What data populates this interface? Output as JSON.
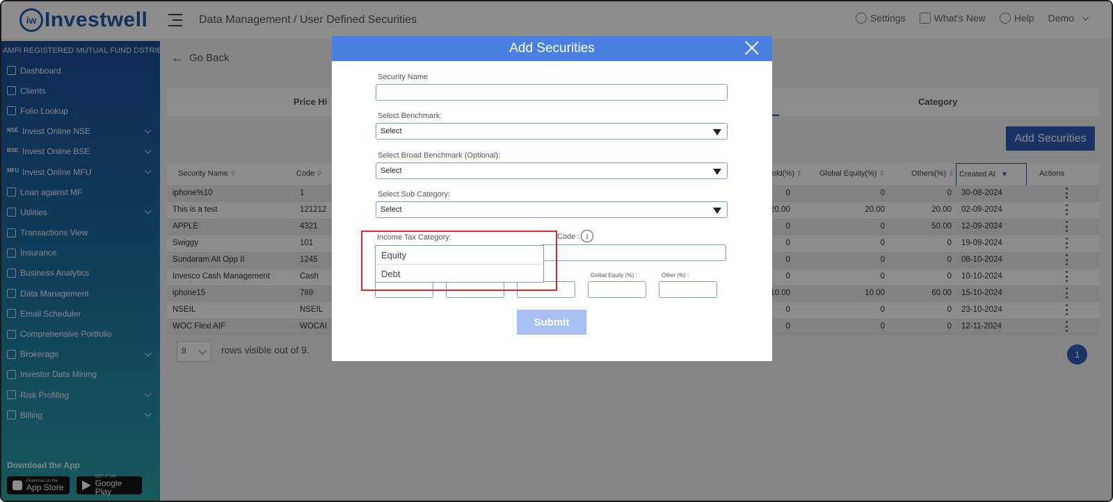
{
  "header": {
    "logo_mark": "iw",
    "logo_text": "Investwell",
    "breadcrumb": "Data Management / User Defined Securities",
    "settings": "Settings",
    "whats_new": "What's New",
    "help": "Help",
    "user": "Demo"
  },
  "sidebar": {
    "title": "AMFI REGISTERED MUTUAL FUND DSTRIBUTOR",
    "items": [
      {
        "label": "Dashboard",
        "icon": "home-icon",
        "chevron": false
      },
      {
        "label": "Clients",
        "icon": "users-icon",
        "chevron": false
      },
      {
        "label": "Folio Lookup",
        "icon": "folio-search-icon",
        "chevron": false
      },
      {
        "label": "Invest Online NSE",
        "icon": "NSE",
        "chevron": true
      },
      {
        "label": "Invest Online BSE",
        "icon": "BSE",
        "chevron": true
      },
      {
        "label": "Invest Online MFU",
        "icon": "MFU",
        "chevron": true
      },
      {
        "label": "Loan against MF",
        "icon": "loan-icon",
        "chevron": false
      },
      {
        "label": "Utilities",
        "icon": "utilities-icon",
        "chevron": true
      },
      {
        "label": "Transactions View",
        "icon": "transactions-icon",
        "chevron": false
      },
      {
        "label": "Insurance",
        "icon": "insurance-icon",
        "chevron": false
      },
      {
        "label": "Business Analytics",
        "icon": "analytics-icon",
        "chevron": false
      },
      {
        "label": "Data Management",
        "icon": "database-icon",
        "chevron": false
      },
      {
        "label": "Email Scheduler",
        "icon": "email-icon",
        "chevron": false
      },
      {
        "label": "Comprehensive Portfolio",
        "icon": "portfolio-icon",
        "chevron": false
      },
      {
        "label": "Brokerage",
        "icon": "brokerage-icon",
        "chevron": true
      },
      {
        "label": "Investor Data Mining",
        "icon": "data-mining-icon",
        "chevron": false
      },
      {
        "label": "Risk Profiling",
        "icon": "risk-icon",
        "chevron": true
      },
      {
        "label": "Billing",
        "icon": "billing-icon",
        "chevron": true
      }
    ],
    "download_title": "Download the App",
    "app_store_small": "Download on the",
    "app_store": "App Store",
    "google_play_small": "GET IT ON",
    "google_play": "Google Play"
  },
  "main": {
    "go_back": "Go Back",
    "tab_price_history": "Price Hi",
    "tab_category": "Category",
    "add_securities": "Add Securities",
    "columns": {
      "security_name": "Security Name",
      "code": "Code",
      "gold": "old(%)",
      "global_equity": "Global Equity(%)",
      "others": "Others(%)",
      "created_at": "Created At",
      "actions": "Actions"
    },
    "rows": [
      {
        "name": "iphone%10",
        "code": "1",
        "gold": "0",
        "global_equity": "0",
        "others": "0",
        "created_at": "30-08-2024"
      },
      {
        "name": "This is a test",
        "code": "121212",
        "gold": "20.00",
        "global_equity": "20.00",
        "others": "20.00",
        "created_at": "02-09-2024"
      },
      {
        "name": "APPLE",
        "code": "4321",
        "gold": "0",
        "global_equity": "0",
        "others": "50.00",
        "created_at": "12-09-2024"
      },
      {
        "name": "Swiggy",
        "code": "101",
        "gold": "0",
        "global_equity": "0",
        "others": "0",
        "created_at": "19-09-2024"
      },
      {
        "name": "Sundaram Alt Opp II",
        "code": "1245",
        "gold": "0",
        "global_equity": "0",
        "others": "0",
        "created_at": "08-10-2024"
      },
      {
        "name": "Invesco Cash Management",
        "code": "Cash",
        "gold": "0",
        "global_equity": "0",
        "others": "0",
        "created_at": "10-10-2024"
      },
      {
        "name": "iphone15",
        "code": "789",
        "gold": "10.00",
        "global_equity": "10.00",
        "others": "60.00",
        "created_at": "15-10-2024"
      },
      {
        "name": "NSEIL",
        "code": "NSEIL",
        "gold": "0",
        "global_equity": "0",
        "others": "0",
        "created_at": "23-10-2024"
      },
      {
        "name": "WOC Flexi AIF",
        "code": "WOCAI",
        "gold": "0",
        "global_equity": "0",
        "others": "0",
        "created_at": "12-11-2024"
      }
    ],
    "rows_per_page": "9",
    "rows_text": "rows visible out of 9.",
    "page": "1"
  },
  "modal": {
    "title": "Add Securities",
    "security_name_label": "Security Name",
    "security_name_value": "",
    "benchmark_label": "Select Benchmark:",
    "benchmark_value": "Select",
    "broad_benchmark_label": "Select Broad Benchmark (Optional):",
    "broad_benchmark_value": "Select",
    "sub_category_label": "Select Sub Category:",
    "sub_category_value": "Select",
    "income_tax_label": "Income Tax Category:",
    "code_label": "Code :",
    "global_equity_label": "Global Equity (%) :",
    "other_label": "Other (%) :",
    "dropdown_options": [
      "Equity",
      "Debt"
    ],
    "submit": "Submit"
  },
  "colors": {
    "brand": "#1e5aa8",
    "modal_header": "#4a80e2",
    "highlight": "#e32626",
    "submit_disabled": "#a7c0f1"
  }
}
